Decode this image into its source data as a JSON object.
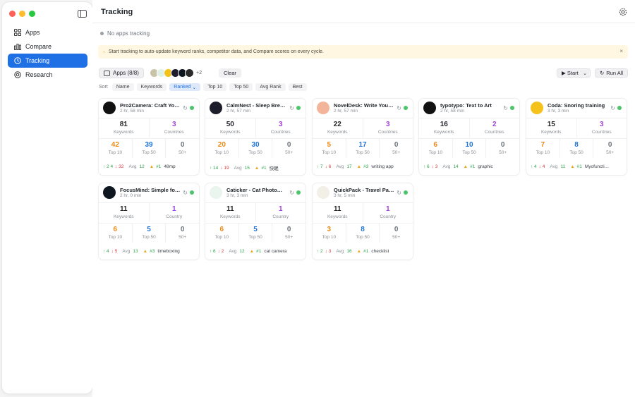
{
  "sidebar": {
    "items": [
      {
        "label": "Apps",
        "icon": "grid-icon"
      },
      {
        "label": "Compare",
        "icon": "bar-chart-icon"
      },
      {
        "label": "Tracking",
        "icon": "clock-icon",
        "active": true
      },
      {
        "label": "Research",
        "icon": "target-icon"
      }
    ]
  },
  "header": {
    "title": "Tracking"
  },
  "status": {
    "text": "No apps tracking"
  },
  "banner": {
    "text": "Start tracking to auto-update keyword ranks, competitor data, and Compare scores on every cycle.",
    "close": "×"
  },
  "toolbar": {
    "apps_label": "Apps (8/8)",
    "more_count": "+2",
    "clear_label": "Clear",
    "start_label": "▶ Start",
    "run_all_label": "Run All"
  },
  "sort": {
    "label": "Sort",
    "options": [
      "Name",
      "Keywords",
      "Ranked",
      "Top 10",
      "Top 50",
      "Avg Rank",
      "Best"
    ],
    "active": "Ranked"
  },
  "labels": {
    "keywords": "Keywords",
    "top10": "Top 10",
    "top50": "Top 50",
    "plus50": "50+",
    "avg": "Avg"
  },
  "cards": [
    {
      "name": "Pro2Camera: Craft Yo…",
      "time": "2 hr, 58 min",
      "keywords": "81",
      "countries": "3",
      "countries_label": "Countries",
      "top10": "42",
      "top50": "39",
      "plus50": "0",
      "up": "↑ 2 4",
      "down": "↓ 32",
      "avg": "12",
      "best": "#1",
      "keyword": "48mp",
      "logo_color": "#111111"
    },
    {
      "name": "CalmNest - Sleep Bre…",
      "time": "2 hr, 57 min",
      "keywords": "50",
      "countries": "3",
      "countries_label": "Countries",
      "top10": "20",
      "top50": "30",
      "plus50": "0",
      "up": "↑ 14",
      "down": "↓ 19",
      "avg": "15",
      "best": "#1",
      "keyword": "快眠",
      "logo_color": "#1d1d2b"
    },
    {
      "name": "NovelDesk: Write You…",
      "time": "2 hr, 57 min",
      "keywords": "22",
      "countries": "3",
      "countries_label": "Countries",
      "top10": "5",
      "top50": "17",
      "plus50": "0",
      "up": "↑ 7",
      "down": "↓ 6",
      "avg": "17",
      "best": "#3",
      "keyword": "writing app",
      "logo_color": "#f2b59a"
    },
    {
      "name": "typotypo: Text to Art",
      "time": "2 hr, 58 min",
      "keywords": "16",
      "countries": "2",
      "countries_label": "Countries",
      "top10": "6",
      "top50": "10",
      "plus50": "0",
      "up": "↑ 6",
      "down": "↓ 3",
      "avg": "14",
      "best": "#1",
      "keyword": "graphic",
      "logo_color": "#121212"
    },
    {
      "name": "Coda: Snoring training",
      "time": "3 hr, 3 min",
      "keywords": "15",
      "countries": "3",
      "countries_label": "Countries",
      "top10": "7",
      "top50": "8",
      "plus50": "0",
      "up": "↑ 4",
      "down": "↓ 4",
      "avg": "11",
      "best": "#1",
      "keyword": "Myofuncti…",
      "logo_color": "#f5c21b"
    },
    {
      "name": "FocusMind: Simple fo…",
      "time": "2 hr, 0 min",
      "keywords": "11",
      "countries": "1",
      "countries_label": "Country",
      "top10": "6",
      "top50": "5",
      "plus50": "0",
      "up": "↑ 4",
      "down": "↓ 5",
      "avg": "13",
      "best": "#3",
      "keyword": "timeboxing",
      "logo_color": "#0e1620"
    },
    {
      "name": "Caticker - Cat Photo…",
      "time": "3 hr, 3 min",
      "keywords": "11",
      "countries": "1",
      "countries_label": "Country",
      "top10": "6",
      "top50": "5",
      "plus50": "0",
      "up": "↑ 6",
      "down": "↓ 2",
      "avg": "12",
      "best": "#1",
      "keyword": "cat camera",
      "logo_color": "#e9f5ee"
    },
    {
      "name": "QuickPack - Travel Pa…",
      "time": "3 hr, 5 min",
      "keywords": "11",
      "countries": "1",
      "countries_label": "Country",
      "top10": "3",
      "top50": "8",
      "plus50": "0",
      "up": "↑ 2",
      "down": "↓ 3",
      "avg": "16",
      "best": "#1",
      "keyword": "checklist",
      "logo_color": "#f1efe6"
    }
  ]
}
